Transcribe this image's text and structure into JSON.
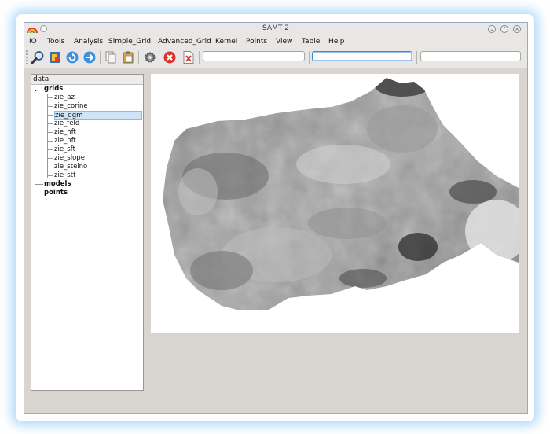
{
  "window": {
    "title": "SAMT 2",
    "buttons": [
      "minimize",
      "maximize",
      "close"
    ]
  },
  "menu": [
    "IO",
    "Tools",
    "Analysis",
    "Simple_Grid",
    "Advanced_Grid",
    "Kernel",
    "Points",
    "View",
    "Table",
    "Help"
  ],
  "toolbar": {
    "icons": [
      "zoom-icon",
      "layers-icon",
      "refresh-icon",
      "forward-icon",
      "copy-icon",
      "paste-icon",
      "settings-icon",
      "stop-icon",
      "close-file-icon"
    ],
    "inputs": [
      "",
      "",
      ""
    ]
  },
  "panel": {
    "header": "data",
    "tree": {
      "grids": {
        "label": "grids",
        "children": [
          "zie_az",
          "zie_corine",
          "zie_dgm",
          "zie_feld",
          "zie_hft",
          "zie_nft",
          "zie_sft",
          "zie_slope",
          "zie_steino",
          "zie_stt"
        ],
        "selected": "zie_dgm"
      },
      "models": "models",
      "points": "points"
    }
  },
  "map": {
    "layer": "zie_dgm"
  }
}
